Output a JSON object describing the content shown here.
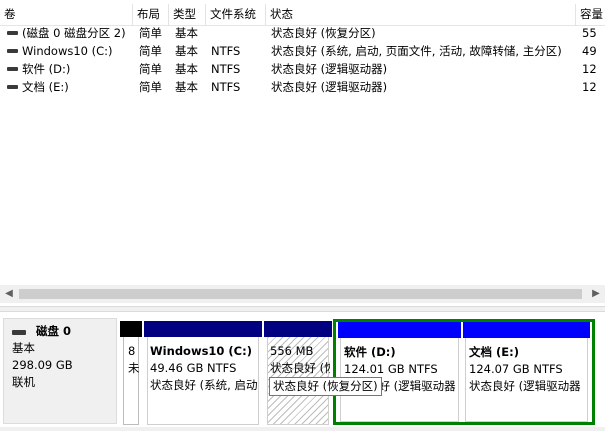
{
  "columns": [
    "卷",
    "布局",
    "类型",
    "文件系统",
    "状态",
    "容量"
  ],
  "volumes": [
    {
      "name": "(磁盘 0 磁盘分区 2)",
      "layout": "简单",
      "type": "基本",
      "fs": "",
      "status": "状态良好 (恢复分区)",
      "capacity": "55"
    },
    {
      "name": "Windows10 (C:)",
      "layout": "简单",
      "type": "基本",
      "fs": "NTFS",
      "status": "状态良好 (系统, 启动, 页面文件, 活动, 故障转储, 主分区)",
      "capacity": "49"
    },
    {
      "name": "软件 (D:)",
      "layout": "简单",
      "type": "基本",
      "fs": "NTFS",
      "status": "状态良好 (逻辑驱动器)",
      "capacity": "12"
    },
    {
      "name": "文档 (E:)",
      "layout": "简单",
      "type": "基本",
      "fs": "NTFS",
      "status": "状态良好 (逻辑驱动器)",
      "capacity": "12"
    }
  ],
  "disk": {
    "name": "磁盘 0",
    "type": "基本",
    "size": "298.09 GB",
    "status": "联机"
  },
  "partitions": {
    "p1": {
      "size": "8",
      "status": "未"
    },
    "c": {
      "title": "Windows10  (C:)",
      "size": "49.46 GB NTFS",
      "status": "状态良好 (系统, 启动"
    },
    "recovery": {
      "size": "556 MB",
      "status": "状态良好 (恢复分区)"
    },
    "d": {
      "title": "软件  (D:)",
      "size": "124.01 GB NTFS",
      "status": "状态良好 (逻辑驱动器"
    },
    "e": {
      "title": "文档  (E:)",
      "size": "124.07 GB NTFS",
      "status": "状态良好 (逻辑驱动器"
    }
  },
  "tooltip": "状态良好 (恢复分区)",
  "colors": {
    "primary": "#000080",
    "extended": "#0000ff",
    "unallocated": "#000000",
    "selected": "#008000"
  }
}
